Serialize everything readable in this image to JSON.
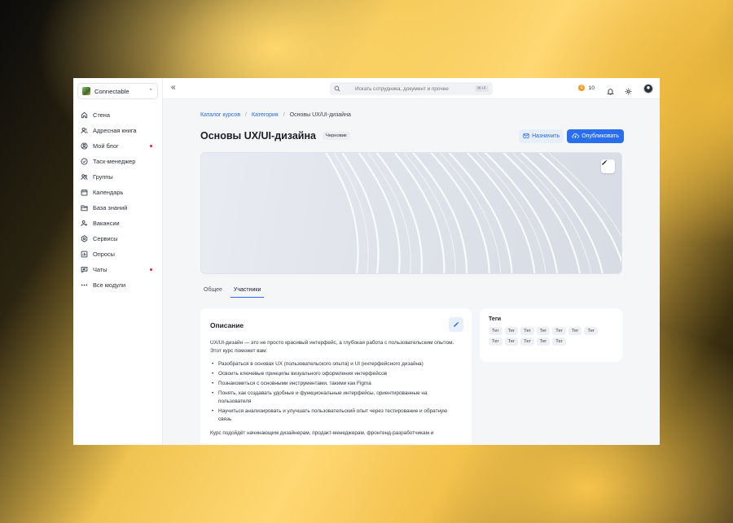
{
  "sidebar": {
    "org_name": "Connectable",
    "items": [
      {
        "label": "Стена",
        "icon": "home-icon",
        "dot": false
      },
      {
        "label": "Адресная книга",
        "icon": "contacts-icon",
        "dot": false
      },
      {
        "label": "Мой блог",
        "icon": "blog-icon",
        "dot": true
      },
      {
        "label": "Таск-менеджер",
        "icon": "task-check-icon",
        "dot": false
      },
      {
        "label": "Группы",
        "icon": "groups-icon",
        "dot": false
      },
      {
        "label": "Календарь",
        "icon": "calendar-icon",
        "dot": false
      },
      {
        "label": "База знаний",
        "icon": "folder-icon",
        "dot": false
      },
      {
        "label": "Вакансии",
        "icon": "vacancy-icon",
        "dot": false
      },
      {
        "label": "Сервисы",
        "icon": "services-icon",
        "dot": false
      },
      {
        "label": "Опросы",
        "icon": "polls-icon",
        "dot": false
      },
      {
        "label": "Чаты",
        "icon": "chat-icon",
        "dot": true
      },
      {
        "label": "Все модули",
        "icon": "more-dots-icon",
        "dot": false
      }
    ]
  },
  "topbar": {
    "search_placeholder": "Искать сотрудника, документ и прочее",
    "search_shortcut": "⌘+K",
    "coins": "10"
  },
  "breadcrumb": {
    "items": [
      "Каталог курсов",
      "Категория"
    ],
    "current": "Основы UX/UI-дизайна"
  },
  "page": {
    "title": "Основы UX/UI-дизайна",
    "badge": "Черновик",
    "assign_label": "Назначить",
    "publish_label": "Опубликовать"
  },
  "tabs": [
    "Общее",
    "Участники"
  ],
  "description": {
    "title": "Описание",
    "intro": "UX/UI-дизайн — это не просто красивый интерфейс, а глубокая работа с пользовательским опытом. Этот курс поможет вам:",
    "points": [
      "Разобраться в основах UX (пользовательского опыта) и UI (интерфейсного дизайна)",
      "Освоить ключевые принципы визуального оформления интерфейсов",
      "Познакомиться с основными инструментами, такими как Figma",
      "Понять, как создавать удобные и функциональные интерфейсы, ориентированные на пользователя",
      "Научиться анализировать и улучшать пользовательский опыт через тестирование и обратную связь"
    ],
    "outro": "Курс подойдёт начинающим дизайнерам, продакт-менеджерам, фронтенд-разработчикам и"
  },
  "tags": {
    "title": "Теги",
    "items": [
      "Тег",
      "Тег",
      "Тег",
      "Тег",
      "Тег",
      "Тег",
      "Тег",
      "Тег",
      "Тег",
      "Тег",
      "Тег",
      "Тег"
    ]
  },
  "colors": {
    "accent": "#2a6ef0",
    "link": "#2768e8",
    "notification_dot": "#e0263d",
    "coin": "#f39a1f"
  }
}
